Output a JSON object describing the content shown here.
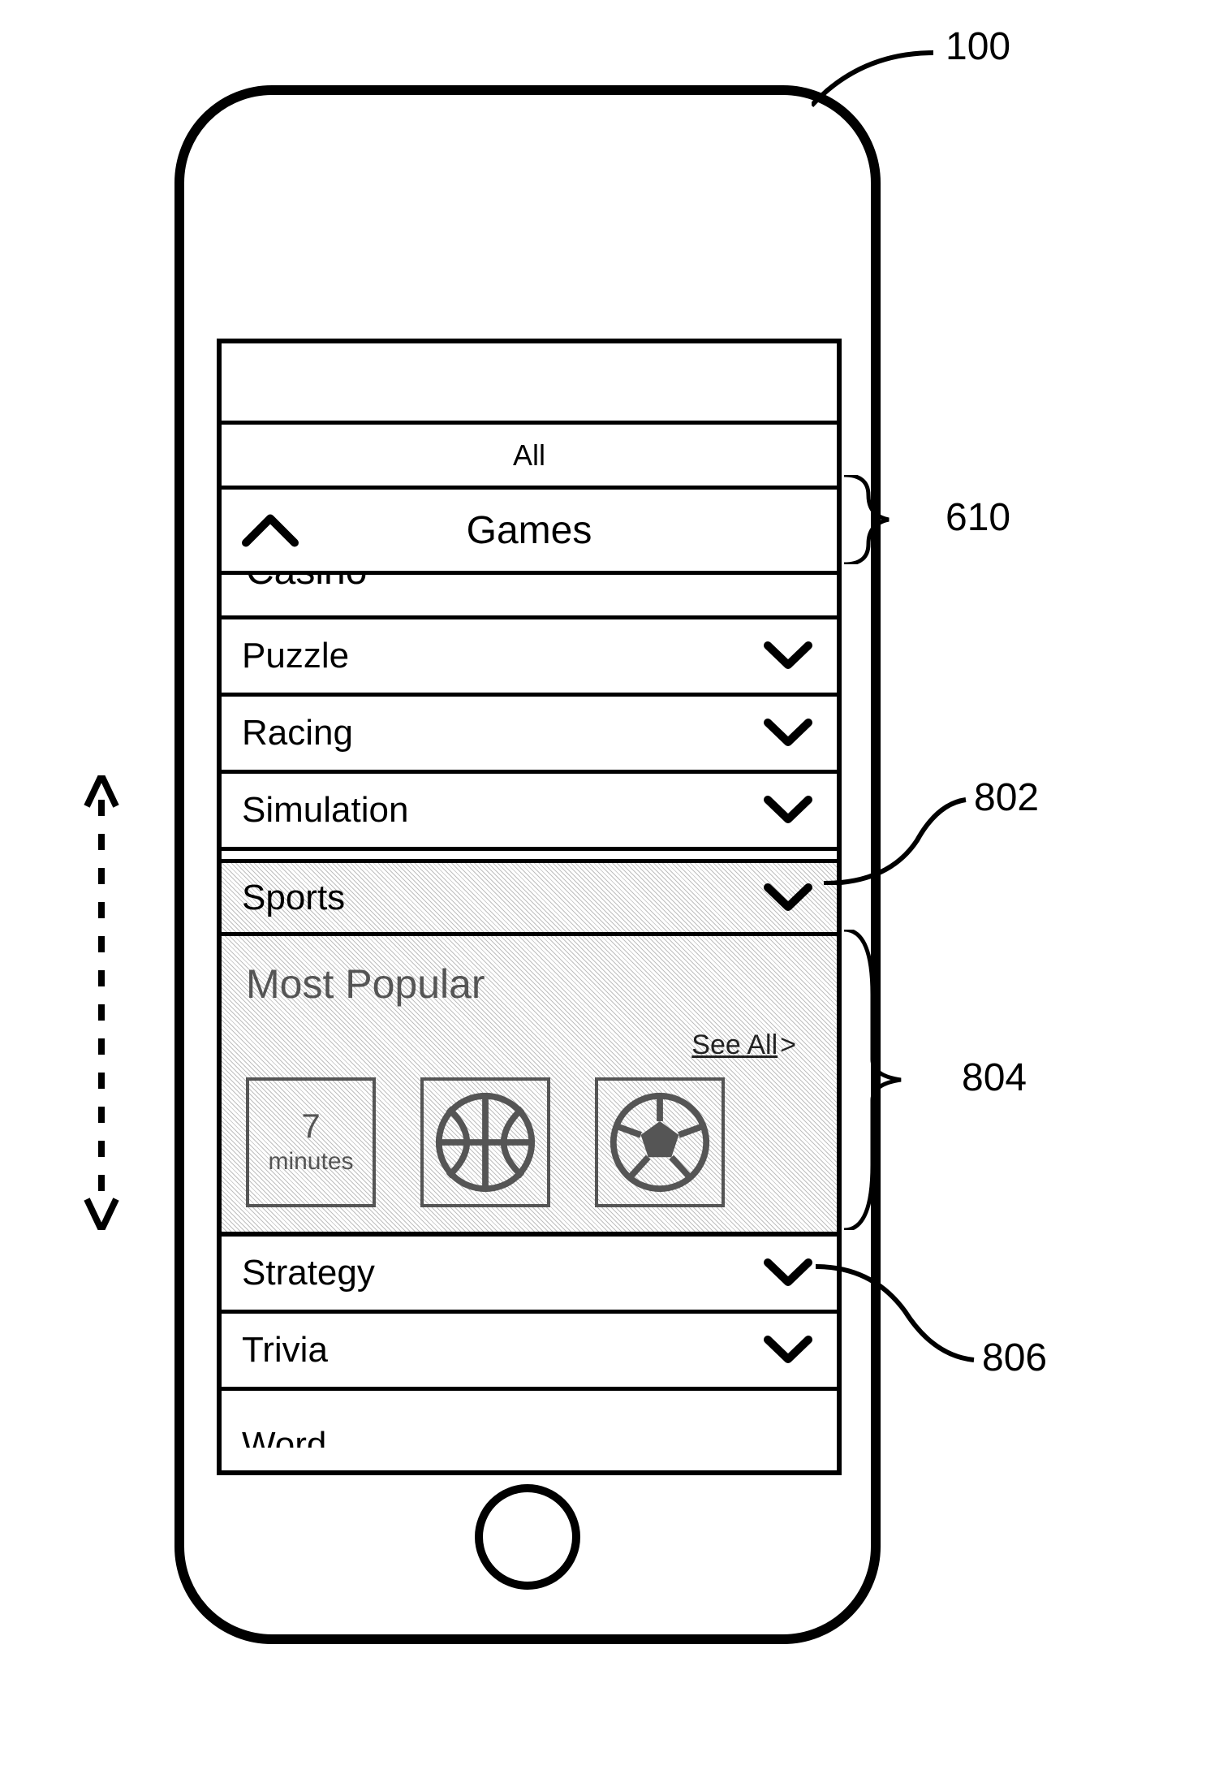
{
  "callouts": {
    "c100": "100",
    "c610": "610",
    "c802": "802",
    "c804": "804",
    "c806": "806"
  },
  "header": {
    "all_label": "All",
    "section_label": "Games"
  },
  "categories": {
    "cut_top": "Casino",
    "puzzle": "Puzzle",
    "racing": "Racing",
    "simulation": "Simulation",
    "sports": "Sports",
    "strategy": "Strategy",
    "trivia": "Trivia",
    "cut_bottom": "Word"
  },
  "expanded": {
    "title": "Most Popular",
    "see_all": "See All",
    "tiles": {
      "t0_line1": "7",
      "t0_line2": "minutes"
    }
  }
}
